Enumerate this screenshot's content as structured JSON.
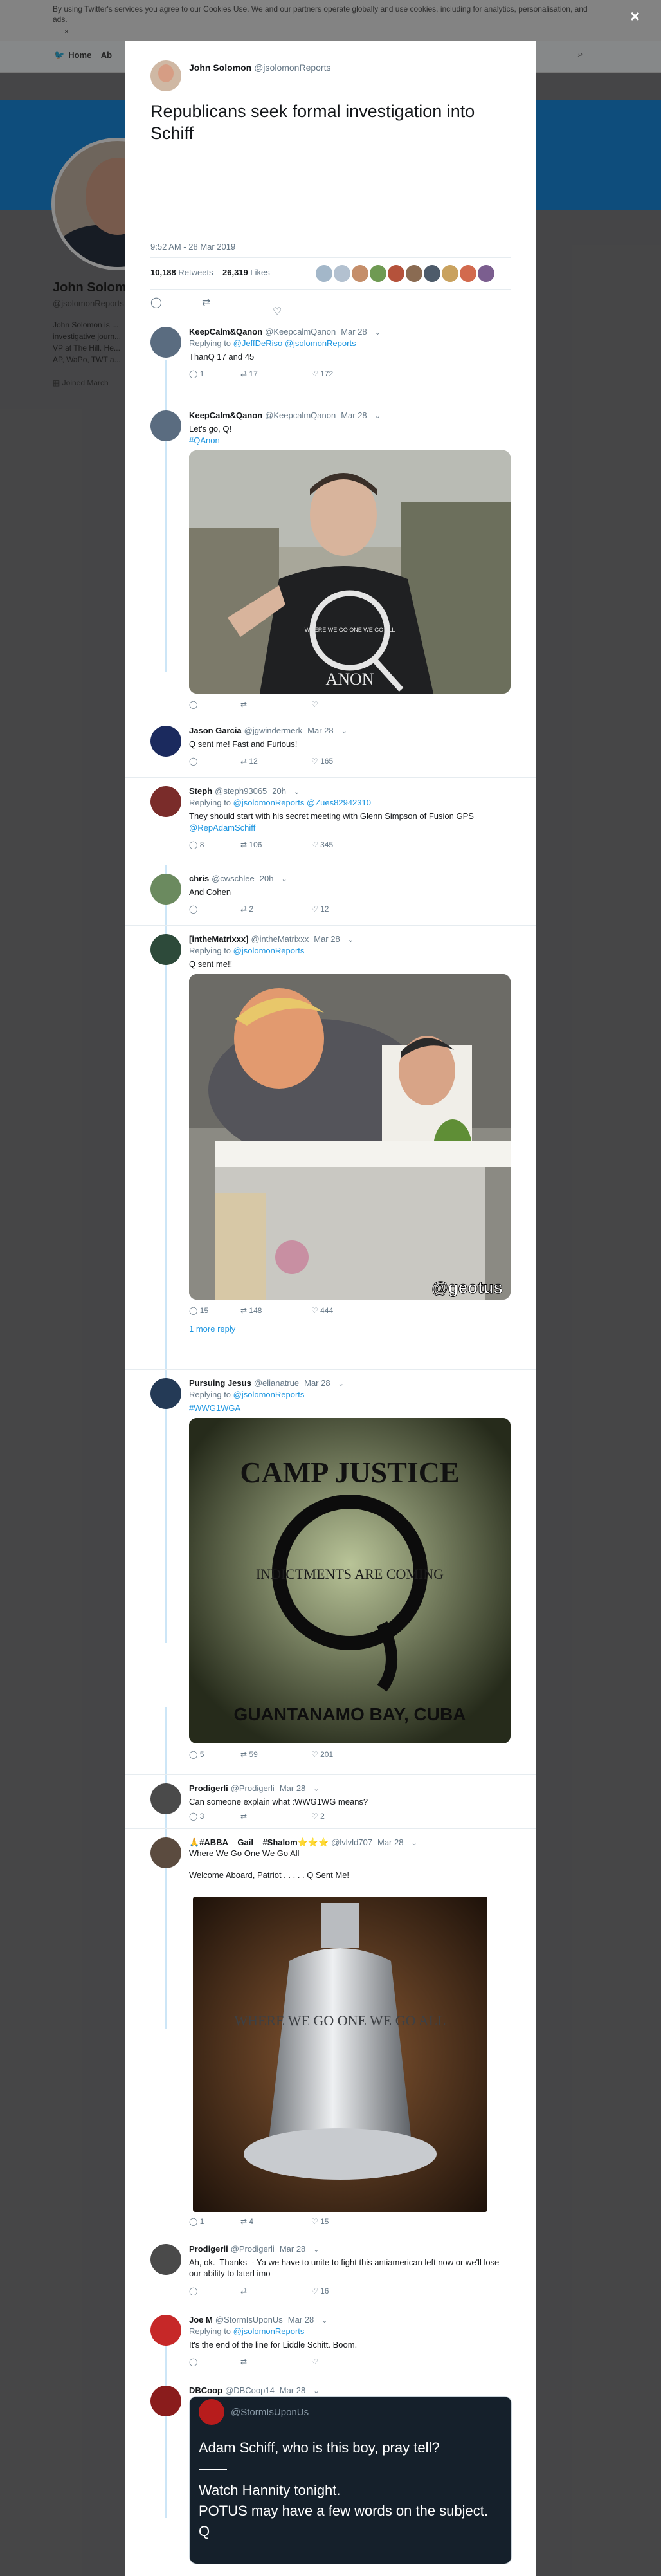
{
  "background": {
    "cookie_text": "By using Twitter's services you agree to our Cookies Use. We and our partners operate globally and use cookies, including for analytics, personalisation, and ads.",
    "cookie_link": "Cookies Use",
    "cookie_dismiss": "×",
    "nav_home": "Home",
    "nav_about": "Ab",
    "profile_name": "John Solomon",
    "profile_handle": "@jsolomonReports",
    "profile_bio": "John Solomon is ... investigative journ... VP at The Hill. He... AP, WaPo, TWT a...",
    "joined": "Joined March",
    "close_label": "×"
  },
  "tweet": {
    "author_name": "John Solomon",
    "author_handle": "@jsolomonReports",
    "text": "Republicans seek formal investigation into Schiff",
    "timestamp": "9:52 AM - 28 Mar 2019",
    "retweets_count": "10,188",
    "retweets_label": "Retweets",
    "likes_count": "26,319",
    "likes_label": "Likes"
  },
  "replies": [
    {
      "name": "KeepCalm&Qanon",
      "handle": "@KeepcalmQanon",
      "time": "Mar 28",
      "replying_label": "Replying to",
      "replying_to": "@JeffDeRiso @jsolomonReports",
      "text": "ThanQ 17 and 45",
      "replies": "1",
      "retweets": "17",
      "likes": "172"
    },
    {
      "name": "KeepCalm&Qanon",
      "handle": "@KeepcalmQanon",
      "time": "Mar 28",
      "text": "Let's go, Q!",
      "hashtag": "#QAnon",
      "shirt_text": "WHERE WE GO ONE WE GO ALL",
      "shirt_word": "ANON"
    },
    {
      "name": "Jason Garcia",
      "handle": "@jgwindermerk",
      "time": "Mar 28",
      "text": "Q sent me! Fast and Furious!",
      "replies": "",
      "retweets": "12",
      "likes": "165"
    },
    {
      "name": "Steph",
      "handle": "@steph93065",
      "time": "20h",
      "replying_label": "Replying to",
      "replying_to": "@jsolomonReports @Zues82942310",
      "text": "They should start with his secret meeting with Glenn Simpson of Fusion GPS",
      "mention": "@RepAdamSchiff",
      "replies": "8",
      "retweets": "106",
      "likes": "345"
    },
    {
      "name": "chris",
      "handle": "@cwschlee",
      "time": "20h",
      "text": "And Cohen",
      "replies": "",
      "retweets": "2",
      "likes": "12"
    },
    {
      "name": "[intheMatrixxx]",
      "handle": "@intheMatrixxx",
      "time": "Mar 28",
      "replying_label": "Replying to",
      "replying_to": "@jsolomonReports",
      "text": "Q sent me!!",
      "watermark": "@geotus",
      "replies": "15",
      "retweets": "148",
      "likes": "444",
      "more": "1 more reply"
    },
    {
      "name": "Pursuing Jesus",
      "handle": "@elianatrue",
      "time": "Mar 28",
      "replying_label": "Replying to",
      "replying_to": "@jsolomonReports",
      "hashtag": "#WWG1WGA",
      "poster_top": "CAMP JUSTICE",
      "poster_mid": "INDICTMENTS ARE COMING",
      "poster_bottom": "GUANTANAMO BAY, CUBA",
      "replies": "5",
      "retweets": "59",
      "likes": "201"
    },
    {
      "name": "Prodigerli",
      "handle": "@Prodigerli",
      "time": "Mar 28",
      "text": "Can someone explain what :WWG1WG means?",
      "replies": "3",
      "retweets": "",
      "likes": "2"
    },
    {
      "name": "🙏#ABBA__Gail__#Shalom⭐⭐⭐",
      "handle": "@lvlvld707",
      "time": "Mar 28",
      "text": "Where We Go One We Go All\n\nWelcome Aboard, Patriot . . . . . Q Sent Me!",
      "bell_text": "WHERE WE GO ONE WE GO ALL",
      "replies": "1",
      "retweets": "4",
      "likes": "15"
    },
    {
      "name": "Prodigerli",
      "handle": "@Prodigerli",
      "time": "Mar 28",
      "text": "Ah, ok.  Thanks  - Ya we have to unite to fight this antiamerican left now or we'll lose our ability to laterl imo",
      "replies": "",
      "retweets": "",
      "likes": "16"
    },
    {
      "name": "Joe M",
      "handle": "@StormIsUponUs",
      "time": "Mar 28",
      "replying_label": "Replying to",
      "replying_to": "@jsolomonReports",
      "text": "It's the end of the line for Liddle Schitt. Boom."
    },
    {
      "name": "DBCoop",
      "handle": "@DBCoop14",
      "time": "Mar 28",
      "quote_handle": "@StormIsUponUs",
      "quote_line1": "Adam Schiff, who is this boy, pray tell?",
      "quote_line2": "——",
      "quote_line3": "Watch Hannity tonight.",
      "quote_line4": "POTUS may have a few words on the subject.",
      "quote_line5": "Q"
    }
  ],
  "icons": {
    "reply": "reply-icon",
    "retweet": "retweet-icon",
    "like": "heart-icon",
    "more": "chevron-down-icon"
  }
}
